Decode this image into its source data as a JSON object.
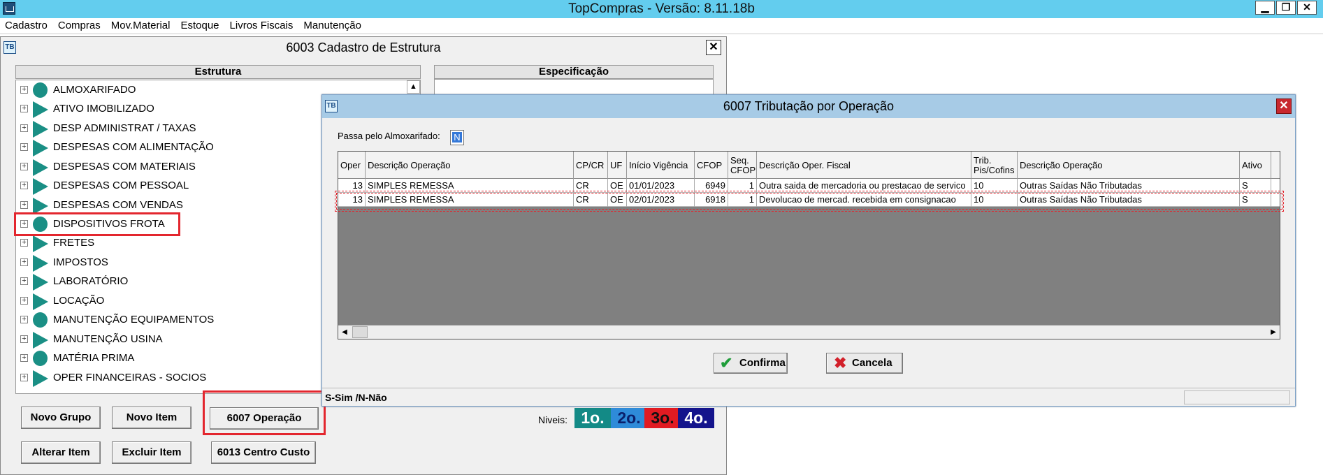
{
  "app": {
    "title": "TopCompras - Versão: 8.11.18b",
    "min": "▁",
    "max": "❐",
    "close": "✕"
  },
  "menu": [
    "Cadastro",
    "Compras",
    "Mov.Material",
    "Estoque",
    "Livros Fiscais",
    "Manutenção"
  ],
  "cadastro": {
    "title": "6003 Cadastro de Estrutura",
    "close": "✕",
    "estrutura_header": "Estrutura",
    "especificacao_header": "Especificação",
    "tree": [
      {
        "label": "ALMOXARIFADO",
        "icon": "circle"
      },
      {
        "label": "ATIVO IMOBILIZADO",
        "icon": "flag"
      },
      {
        "label": "DESP ADMINISTRAT / TAXAS",
        "icon": "flag"
      },
      {
        "label": "DESPESAS COM ALIMENTAÇÃO",
        "icon": "flag"
      },
      {
        "label": "DESPESAS COM MATERIAIS",
        "icon": "flag"
      },
      {
        "label": "DESPESAS COM PESSOAL",
        "icon": "flag"
      },
      {
        "label": "DESPESAS COM VENDAS",
        "icon": "flag"
      },
      {
        "label": "DISPOSITIVOS FROTA",
        "icon": "circle"
      },
      {
        "label": "FRETES",
        "icon": "flag"
      },
      {
        "label": "IMPOSTOS",
        "icon": "flag"
      },
      {
        "label": "LABORATÓRIO",
        "icon": "flag"
      },
      {
        "label": "LOCAÇÃO",
        "icon": "flag"
      },
      {
        "label": "MANUTENÇÃO EQUIPAMENTOS",
        "icon": "circle"
      },
      {
        "label": "MANUTENÇÃO USINA",
        "icon": "flag"
      },
      {
        "label": "MATÉRIA PRIMA",
        "icon": "circle"
      },
      {
        "label": "OPER FINANCEIRAS - SOCIOS",
        "icon": "flag"
      }
    ],
    "buttons": {
      "novo_grupo": "Novo Grupo",
      "novo_item": "Novo Item",
      "operacao": "6007 Operação",
      "alterar_item": "Alterar Item",
      "excluir_item": "Excluir Item",
      "centro_custo": "6013 Centro Custo"
    },
    "niveis_label": "Niveis:",
    "niveis": [
      {
        "label": "1o.",
        "color": "#138a86"
      },
      {
        "label": "2o.",
        "color": "#2e8bd9"
      },
      {
        "label": "3o.",
        "color": "#e11b22"
      },
      {
        "label": "4o.",
        "color": "#14148c"
      }
    ]
  },
  "tributacao": {
    "title": "6007 Tributação por Operação",
    "close": "✕",
    "almox_label": "Passa pelo Almoxarifado:",
    "almox_value": "N",
    "columns": [
      "Oper",
      "Descrição Operação",
      "CP/CR",
      "UF",
      "Início Vigência",
      "CFOP",
      "Seq. CFOP",
      "Descrição Oper. Fiscal",
      "Trib. Pis/Cofins",
      "Descrição Operação",
      "Ativo"
    ],
    "rows": [
      [
        "13",
        "SIMPLES REMESSA",
        "CR",
        "OE",
        "01/01/2023",
        "6949",
        "1",
        "Outra saida de mercadoria ou prestacao de servico",
        "10",
        "Outras Saídas Não Tributadas",
        "S"
      ],
      [
        "13",
        "SIMPLES REMESSA",
        "CR",
        "OE",
        "02/01/2023",
        "6918",
        "1",
        "Devolucao de mercad. recebida em consignacao",
        "10",
        "Outras Saídas Não Tributadas",
        "S"
      ]
    ],
    "confirma": "Confirma",
    "cancela": "Cancela",
    "status": "S-Sim /N-Não"
  }
}
